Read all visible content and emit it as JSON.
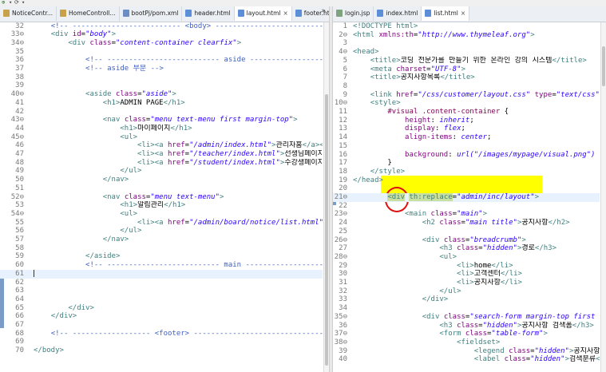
{
  "toolbar": {
    "items": [
      "⊕",
      "▾",
      "⟳",
      "▾"
    ]
  },
  "left": {
    "tabs": [
      {
        "label": "NoticeContr...",
        "icon": "java"
      },
      {
        "label": "HomeControll...",
        "icon": "java"
      },
      {
        "label": "bootPj/pom.xml",
        "icon": "xml"
      },
      {
        "label": "header.html",
        "icon": "html"
      },
      {
        "label": "layout.html",
        "icon": "html",
        "closable": true,
        "active": true
      },
      {
        "label": "footer.html",
        "icon": "html"
      }
    ],
    "overflow": "»",
    "lines": [
      {
        "n": "32",
        "html": "    <span class='c'>&lt;!-- ------------------------- &lt;body&gt; ---------------------------------</span>"
      },
      {
        "n": "33⊖",
        "html": "    <span class='t'>&lt;div</span> <span class='a'>id</span>=<span class='v'>\"body\"</span><span class='t'>&gt;</span>"
      },
      {
        "n": "34⊖",
        "html": "        <span class='t'>&lt;div</span> <span class='a'>class</span>=<span class='v'>\"content-container clearfix\"</span><span class='t'>&gt;</span>"
      },
      {
        "n": "35",
        "html": ""
      },
      {
        "n": "36",
        "html": "            <span class='c'>&lt;!-- -------------------------- aside -----------------------</span>"
      },
      {
        "n": "37",
        "html": "            <span class='c'>&lt;!-- aside 부분 --&gt;</span>"
      },
      {
        "n": "38",
        "html": ""
      },
      {
        "n": "39",
        "html": ""
      },
      {
        "n": "40⊖",
        "html": "            <span class='t'>&lt;aside</span> <span class='a'>class</span>=<span class='v'>\"aside\"</span><span class='t'>&gt;</span>"
      },
      {
        "n": "41",
        "html": "                <span class='t'>&lt;h1&gt;</span>ADMIN PAGE<span class='t'>&lt;/h1&gt;</span>"
      },
      {
        "n": "42",
        "html": ""
      },
      {
        "n": "43⊖",
        "html": "                <span class='t'>&lt;nav</span> <span class='a'>class</span>=<span class='v'>\"menu text-menu first margin-top\"</span><span class='t'>&gt;</span>"
      },
      {
        "n": "44",
        "html": "                    <span class='t'>&lt;h1&gt;</span>마이페이지<span class='t'>&lt;/h1&gt;</span>"
      },
      {
        "n": "45⊖",
        "html": "                    <span class='t'>&lt;ul&gt;</span>"
      },
      {
        "n": "46",
        "html": "                        <span class='t'>&lt;li&gt;&lt;a</span> <span class='a'>href</span>=<span class='v'>\"/admin/index.html\"</span><span class='t'>&gt;</span>관리자홈<span class='t'>&lt;/a&gt;&lt;/li&gt;</span>"
      },
      {
        "n": "47",
        "html": "                        <span class='t'>&lt;li&gt;&lt;a</span> <span class='a'>href</span>=<span class='v'>\"/teacher/index.html\"</span><span class='t'>&gt;</span>선생님페이지<span class='t'>&lt;/a&gt;&lt;</span>"
      },
      {
        "n": "48",
        "html": "                        <span class='t'>&lt;li&gt;&lt;a</span> <span class='a'>href</span>=<span class='v'>\"/student/index.html\"</span><span class='t'>&gt;</span>수강생페이지<span class='t'>&lt;/a&gt;&lt;</span>"
      },
      {
        "n": "49",
        "html": "                    <span class='t'>&lt;/ul&gt;</span>"
      },
      {
        "n": "50",
        "html": "                <span class='t'>&lt;/nav&gt;</span>"
      },
      {
        "n": "51",
        "html": ""
      },
      {
        "n": "52⊖",
        "html": "                <span class='t'>&lt;nav</span> <span class='a'>class</span>=<span class='v'>\"menu text-menu\"</span><span class='t'>&gt;</span>"
      },
      {
        "n": "53",
        "html": "                    <span class='t'>&lt;h1&gt;</span>알림관리<span class='t'>&lt;/h1&gt;</span>"
      },
      {
        "n": "54⊖",
        "html": "                    <span class='t'>&lt;ul&gt;</span>"
      },
      {
        "n": "55",
        "html": "                        <span class='t'>&lt;li&gt;&lt;a</span> <span class='a'>href</span>=<span class='v'>\"/admin/board/notice/list.html\"</span><span class='t'>&gt;</span>공지사"
      },
      {
        "n": "56",
        "html": "                    <span class='t'>&lt;/ul&gt;</span>"
      },
      {
        "n": "57",
        "html": "                <span class='t'>&lt;/nav&gt;</span>"
      },
      {
        "n": "58",
        "html": ""
      },
      {
        "n": "59",
        "html": "            <span class='t'>&lt;/aside&gt;</span>"
      },
      {
        "n": "60",
        "html": "            <span class='c'>&lt;!-- -------------------------- main ----------------------</span>"
      },
      {
        "n": "61",
        "html": "<span class='caret'></span>",
        "current": true
      },
      {
        "n": "62",
        "html": ""
      },
      {
        "n": "63",
        "html": ""
      },
      {
        "n": "64",
        "html": ""
      },
      {
        "n": "65",
        "html": "        <span class='t'>&lt;/div&gt;</span>"
      },
      {
        "n": "66",
        "html": "    <span class='t'>&lt;/div&gt;</span>"
      },
      {
        "n": "67",
        "html": ""
      },
      {
        "n": "68",
        "html": "    <span class='c'>&lt;!-- ------------------ &lt;footer&gt; ---------------------------------</span>"
      },
      {
        "n": "69",
        "html": ""
      },
      {
        "n": "70",
        "html": "<span class='t'>&lt;/body&gt;</span>"
      }
    ]
  },
  "right": {
    "tabs": [
      {
        "label": "login.jsp",
        "icon": "jsp"
      },
      {
        "label": "index.html",
        "icon": "html"
      },
      {
        "label": "list.html",
        "icon": "html",
        "closable": true,
        "active": true
      }
    ],
    "lines": [
      {
        "n": "1",
        "html": "<span class='t'>&lt;!DOCTYPE html&gt;</span>"
      },
      {
        "n": "2⊖",
        "html": "<span class='t'>&lt;html</span> <span class='a'>xmlns:th</span>=<span class='v'>\"http://www.thymeleaf.org\"</span><span class='t'>&gt;</span>"
      },
      {
        "n": "3",
        "html": ""
      },
      {
        "n": "4⊖",
        "html": "<span class='t'>&lt;head&gt;</span>"
      },
      {
        "n": "5",
        "html": "    <span class='t'>&lt;title&gt;</span>코딩 전문가를 만들기 위한 온라인 강의 시스템<span class='t'>&lt;/title&gt;</span>"
      },
      {
        "n": "6",
        "html": "    <span class='t'>&lt;meta</span> <span class='a'>charset</span>=<span class='v'>\"UTF-8\"</span><span class='t'>&gt;</span>"
      },
      {
        "n": "7",
        "html": "    <span class='t'>&lt;title&gt;</span>공지사항목록<span class='t'>&lt;/title&gt;</span>"
      },
      {
        "n": "8",
        "html": ""
      },
      {
        "n": "9",
        "html": "    <span class='t'>&lt;link</span> <span class='a'>href</span>=<span class='v'>\"/css/customer/layout.css\"</span> <span class='a'>type</span>=<span class='v'>\"text/css\"</span> <span class='a'>rel</span>"
      },
      {
        "n": "10⊖",
        "html": "    <span class='t'>&lt;style&gt;</span>"
      },
      {
        "n": "11",
        "html": "        <span class='css-sel'>#visual .content-container</span> {"
      },
      {
        "n": "12",
        "html": "            <span class='css-prop'>height</span>: <span class='css-val'>inherit</span>;"
      },
      {
        "n": "13",
        "html": "            <span class='css-prop'>display</span>: <span class='css-val'>flex</span>;"
      },
      {
        "n": "14",
        "html": "            <span class='css-prop'>align-items</span>: <span class='css-val'>center</span>;"
      },
      {
        "n": "15",
        "html": ""
      },
      {
        "n": "16",
        "html": "            <span class='css-prop'>background</span>: <span class='css-val'>url(\"/images/mypage/visual.png\") no-r</span>"
      },
      {
        "n": "17",
        "html": "        }"
      },
      {
        "n": "18",
        "html": "    <span class='t'>&lt;/style&gt;</span>"
      },
      {
        "n": "19",
        "html": "<span class='t'>&lt;/head&gt;</span>"
      },
      {
        "n": "20",
        "html": ""
      },
      {
        "n": "21⊖",
        "html": "        <span class='sel'>&lt;div</span> <span class='sel a'>th:replace</span>=<span class='v'>\"admin/inc/layout\"</span><span class='t'>&gt;</span>",
        "current": true
      },
      {
        "n": "22",
        "html": ""
      },
      {
        "n": "23⊖",
        "html": "            <span class='t'>&lt;main</span> <span class='a'>class</span>=<span class='v'>\"main\"</span><span class='t'>&gt;</span>"
      },
      {
        "n": "24",
        "html": "                <span class='t'>&lt;h2</span> <span class='a'>class</span>=<span class='v'>\"main title\"</span><span class='t'>&gt;</span>공지사항<span class='t'>&lt;/h2&gt;</span>"
      },
      {
        "n": "25",
        "html": ""
      },
      {
        "n": "26⊖",
        "html": "                <span class='t'>&lt;div</span> <span class='a'>class</span>=<span class='v'>\"breadcrumb\"</span><span class='t'>&gt;</span>"
      },
      {
        "n": "27",
        "html": "                    <span class='t'>&lt;h3</span> <span class='a'>class</span>=<span class='v'>\"hidden\"</span><span class='t'>&gt;</span>경로<span class='t'>&lt;/h3&gt;</span>"
      },
      {
        "n": "28⊖",
        "html": "                    <span class='t'>&lt;ul&gt;</span>"
      },
      {
        "n": "29",
        "html": "                        <span class='t'>&lt;li&gt;</span>home<span class='t'>&lt;/li&gt;</span>"
      },
      {
        "n": "30",
        "html": "                        <span class='t'>&lt;li&gt;</span>고객센터<span class='t'>&lt;/li&gt;</span>"
      },
      {
        "n": "31",
        "html": "                        <span class='t'>&lt;li&gt;</span>공지사항<span class='t'>&lt;/li&gt;</span>"
      },
      {
        "n": "32",
        "html": "                    <span class='t'>&lt;/ul&gt;</span>"
      },
      {
        "n": "33",
        "html": "                <span class='t'>&lt;/div&gt;</span>"
      },
      {
        "n": "34",
        "html": ""
      },
      {
        "n": "35⊖",
        "html": "                <span class='t'>&lt;div</span> <span class='a'>class</span>=<span class='v'>\"search-form margin-top first alig</span>"
      },
      {
        "n": "36",
        "html": "                    <span class='t'>&lt;h3</span> <span class='a'>class</span>=<span class='v'>\"hidden\"</span><span class='t'>&gt;</span>공지사항 검색폼<span class='t'>&lt;/h3&gt;</span>"
      },
      {
        "n": "37⊖",
        "html": "                    <span class='t'>&lt;form</span> <span class='a'>class</span>=<span class='v'>\"table-form\"</span><span class='t'>&gt;</span>"
      },
      {
        "n": "38⊖",
        "html": "                        <span class='t'>&lt;fieldset&gt;</span>"
      },
      {
        "n": "39",
        "html": "                            <span class='t'>&lt;legend</span> <span class='a'>class</span>=<span class='v'>\"hidden\"</span><span class='t'>&gt;</span>공지사항 검색"
      },
      {
        "n": "40",
        "html": "                            <span class='t'>&lt;label</span> <span class='a'>class</span>=<span class='v'>\"hidden\"</span><span class='t'>&gt;</span>검색분류<span class='t'>&lt;/lab</span>"
      }
    ]
  }
}
